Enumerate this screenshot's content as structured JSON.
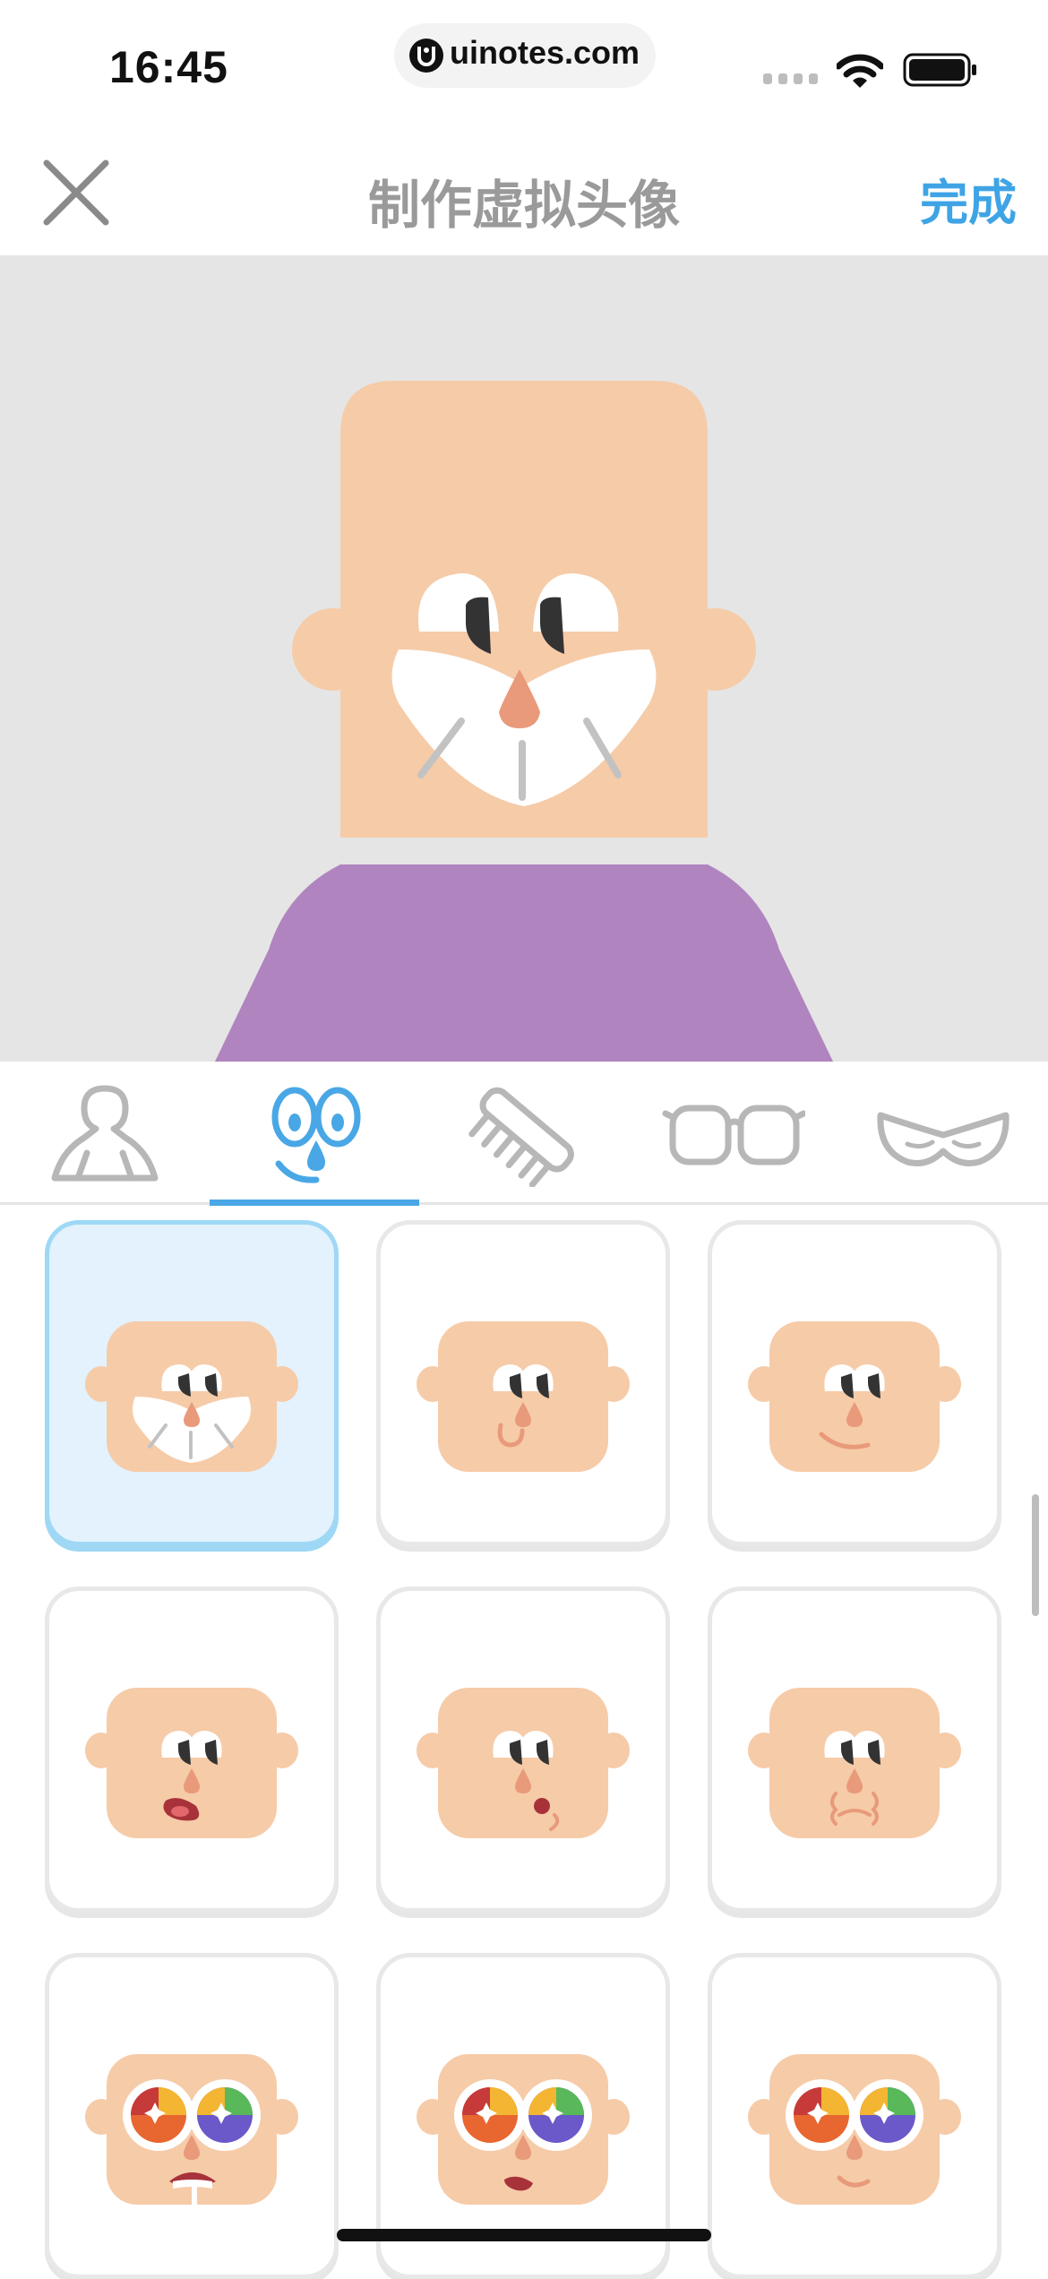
{
  "status_bar": {
    "time": "16:45",
    "url": "uinotes.com",
    "icons": [
      "signal-icon",
      "wifi-icon",
      "battery-icon"
    ]
  },
  "nav": {
    "close_icon": "close-icon",
    "title": "制作虚拟头像",
    "done_label": "完成"
  },
  "colors": {
    "accent": "#3fa4e5",
    "skin": "#f6cba8",
    "shirt": "#b084bf",
    "nose": "#e89a7a",
    "preview_bg": "#e5e5e5",
    "selected_card_bg": "#e3f2fc",
    "selected_card_border": "#9ed8f5"
  },
  "tabs": {
    "items": [
      {
        "icon": "body-icon",
        "active": false
      },
      {
        "icon": "face-icon",
        "active": true
      },
      {
        "icon": "comb-icon",
        "active": false
      },
      {
        "icon": "glasses-icon",
        "active": false
      },
      {
        "icon": "mustache-icon",
        "active": false
      }
    ]
  },
  "options": {
    "items": [
      {
        "name": "big-grin",
        "selected": true
      },
      {
        "name": "smirk",
        "selected": false
      },
      {
        "name": "smile",
        "selected": false
      },
      {
        "name": "tongue-out",
        "selected": false
      },
      {
        "name": "whistle",
        "selected": false
      },
      {
        "name": "puffed-cheeks",
        "selected": false
      },
      {
        "name": "rainbow-eyes-drool",
        "selected": false
      },
      {
        "name": "rainbow-eyes-tongue",
        "selected": false
      },
      {
        "name": "rainbow-eyes-smile",
        "selected": false
      }
    ]
  }
}
